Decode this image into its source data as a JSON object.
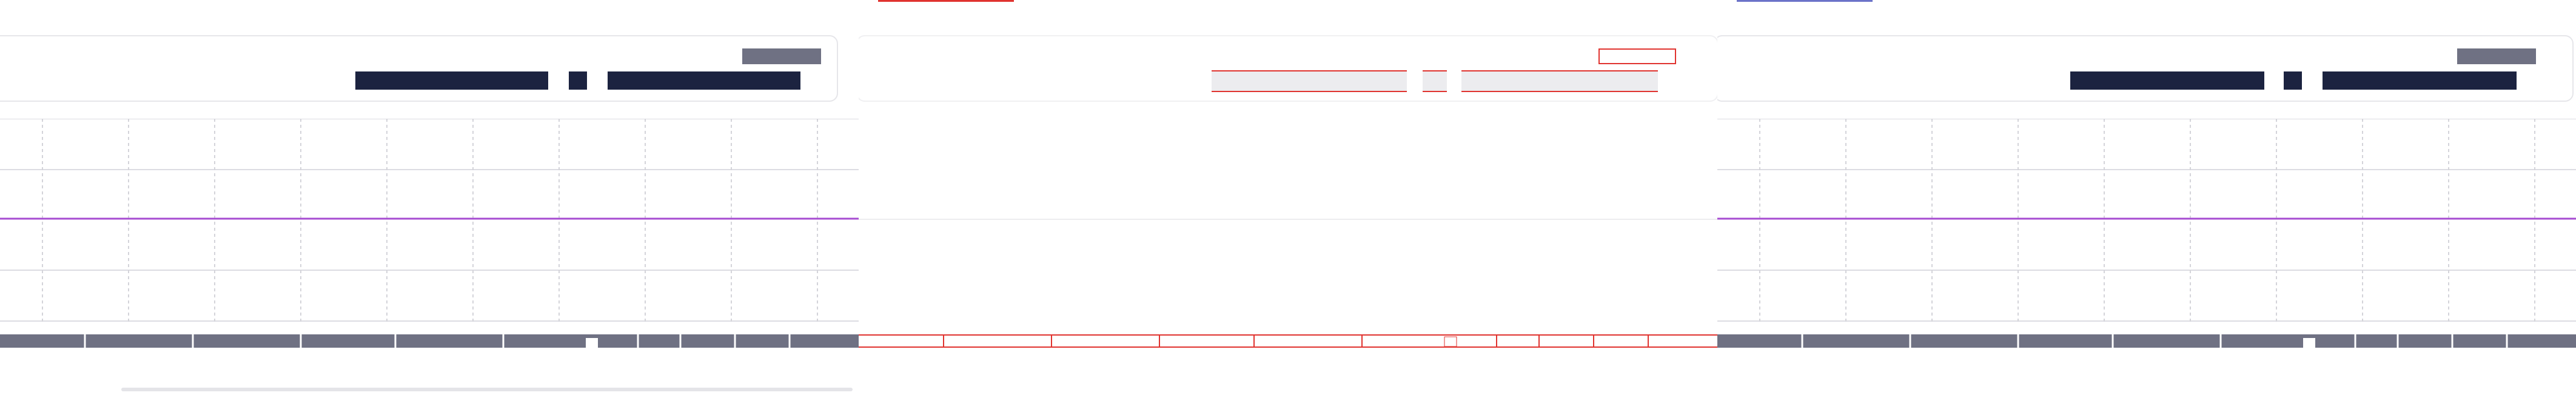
{
  "colors": {
    "page_background": "#ffffff",
    "card_border": "#e6e6ea",
    "badge": "#6f7183",
    "dark_bar": "#1c2340",
    "grid": "#d9d9df",
    "purple_line": "#a64bd1",
    "axis_band": "#6f7183",
    "red_outline": "#e0332f",
    "blue_strip": "#6b73c9"
  },
  "panels": [
    {
      "id": "left",
      "variant": "normal"
    },
    {
      "id": "middle",
      "variant": "outlined-red"
    },
    {
      "id": "right",
      "variant": "normal"
    }
  ]
}
